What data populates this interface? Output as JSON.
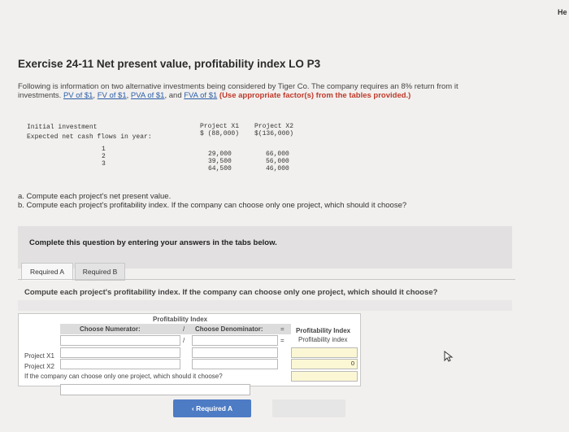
{
  "header": {
    "help_label": "He"
  },
  "title": "Exercise 24-11 Net present value, profitability index LO P3",
  "intro": {
    "line1": "Following is information on two alternative investments being considered by Tiger Co. The company requires an 8% return from it",
    "line2_prefix": "investments.",
    "links": [
      "PV of $1",
      "FV of $1",
      "PVA of $1",
      "FVA of $1"
    ],
    "instruction": "(Use appropriate factor(s) from the tables provided.)"
  },
  "data_table": {
    "headers": [
      "Project X1",
      "Project X2"
    ],
    "initial_label": "Initial investment",
    "initial": [
      "$ (88,000)",
      "$(136,000)"
    ],
    "cashflow_label": "Expected net cash flows in year:",
    "years": [
      "1",
      "2",
      "3"
    ],
    "x1": [
      "29,000",
      "39,500",
      "64,500"
    ],
    "x2": [
      "66,000",
      "56,000",
      "46,000"
    ]
  },
  "questions": {
    "a": "a. Compute each project's net present value.",
    "b": "b. Compute each project's profitability index. If the company can choose only one project, which should it choose?"
  },
  "complete_text": "Complete this question by entering your answers in the tabs below.",
  "tabs": {
    "a": "Required A",
    "b": "Required B"
  },
  "required_b": {
    "instruction": "Compute each project's profitability index. If the company can choose only one project, which should it choose?",
    "worksheet_title": "Profitability Index",
    "numerator_label": "Choose Numerator:",
    "slash": "/",
    "denominator_label": "Choose Denominator:",
    "equals": "=",
    "result_header": "Profitability Index",
    "result_sub": "Profitability index",
    "rows": [
      {
        "label": "Project X1",
        "value": "0"
      },
      {
        "label": "Project X2",
        "value": "0"
      }
    ],
    "choose_question": "If the company can choose only one project, which should it choose?"
  },
  "nav": {
    "prev_label": "Required A",
    "prev_icon": "chevron-left-icon"
  }
}
